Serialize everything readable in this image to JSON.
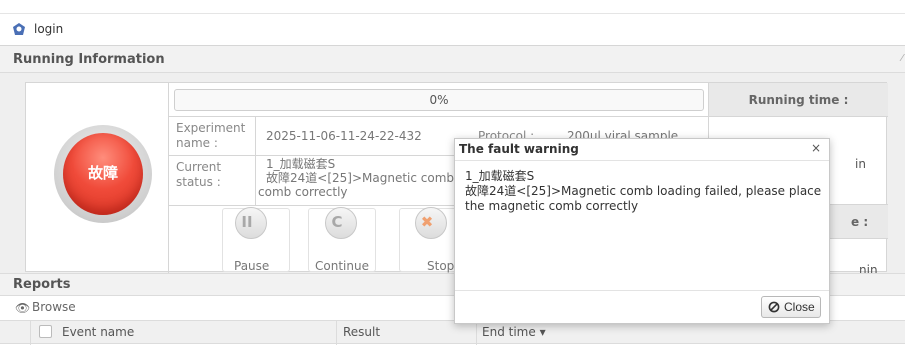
{
  "window": {
    "title": "login",
    "logo_icon": "app-logo-icon"
  },
  "running": {
    "title": "Running Information",
    "status_text": "故障",
    "progress": {
      "percent": 0,
      "label": "0%"
    },
    "experiment_name_label": "Experiment name :",
    "experiment_name": "2025-11-06-11-24-22-432",
    "protocol_label": "Protocol :",
    "protocol": "200ul viral sample",
    "current_status_label": "Current status :",
    "current_status_line1": "1_加载磁套S",
    "current_status_line2": "故障24道<[25]>Magnetic comb",
    "current_status_line3": "comb correctly",
    "running_time_label": "Running time :",
    "running_time_partial": "in",
    "remaining_label_partial": "e :",
    "remaining_value_partial": "nin",
    "controls": [
      {
        "label": "Pause",
        "icon": "pause-icon"
      },
      {
        "label": "Continue",
        "icon": "refresh-icon"
      },
      {
        "label": "Stop",
        "icon": "stop-icon"
      }
    ]
  },
  "reports": {
    "title": "Reports",
    "browse_label": "Browse",
    "columns": [
      "Event name",
      "Result",
      "End time"
    ]
  },
  "modal": {
    "title": "The fault warning",
    "close_x": "×",
    "message_line1": "1_加载磁套S",
    "message_line2": "故障24道<[25]>Magnetic comb loading failed, please place",
    "message_line3": "the magnetic comb correctly",
    "close_button": "Close"
  }
}
